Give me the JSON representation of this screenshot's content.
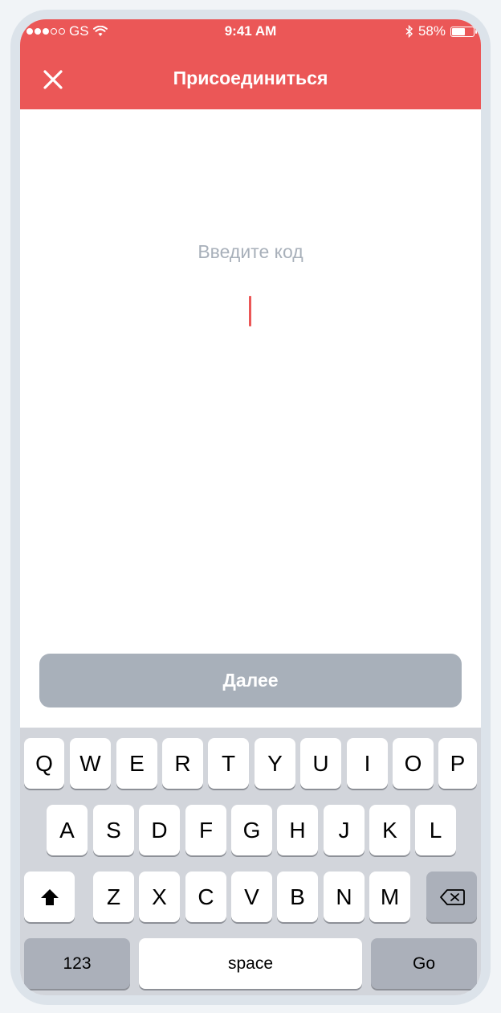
{
  "status_bar": {
    "carrier": "GS",
    "time": "9:41 AM",
    "battery": "58%",
    "battery_level": 0.58,
    "icons": [
      "signal-dots-icon",
      "wifi-icon",
      "bluetooth-icon",
      "battery-icon"
    ]
  },
  "header": {
    "title": "Присоединиться",
    "close_icon": "close-icon",
    "background_color": "#eb5757"
  },
  "form": {
    "prompt": "Введите код",
    "value": "",
    "cursor_color": "#eb5757"
  },
  "actions": {
    "next_label": "Далее",
    "next_color": "#a8b0ba"
  },
  "keyboard": {
    "row1": [
      "Q",
      "W",
      "E",
      "R",
      "T",
      "Y",
      "U",
      "I",
      "O",
      "P"
    ],
    "row2": [
      "A",
      "S",
      "D",
      "F",
      "G",
      "H",
      "J",
      "K",
      "L"
    ],
    "row3": [
      "Z",
      "X",
      "C",
      "V",
      "B",
      "N",
      "M"
    ],
    "numbers_label": "123",
    "space_label": "space",
    "go_label": "Go",
    "shift_icon": "shift-icon",
    "backspace_icon": "backspace-icon"
  }
}
